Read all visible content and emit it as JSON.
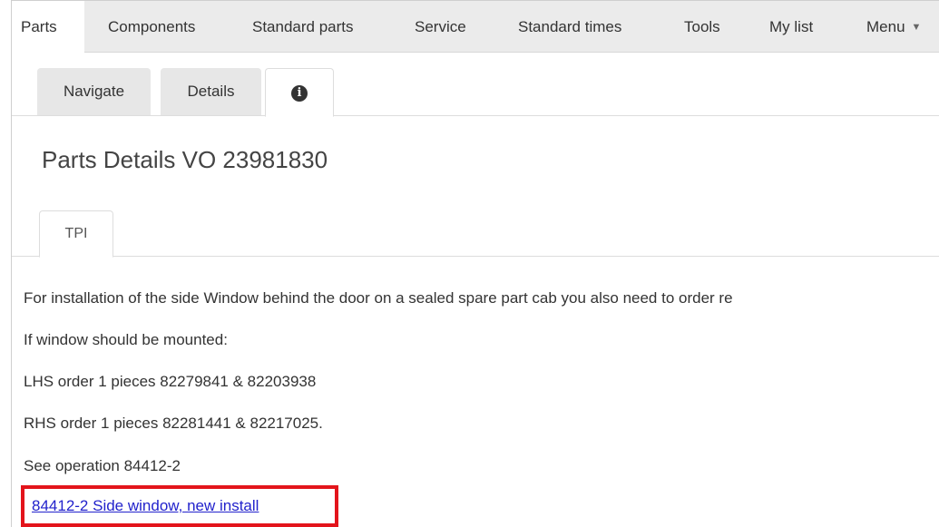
{
  "topnav": {
    "items": [
      {
        "label": "Parts",
        "active": true
      },
      {
        "label": "Components"
      },
      {
        "label": "Standard parts"
      },
      {
        "label": "Service"
      },
      {
        "label": "Standard times"
      },
      {
        "label": "Tools"
      },
      {
        "label": "My list"
      },
      {
        "label": "Menu",
        "icon": "caret-down-icon"
      }
    ]
  },
  "subtabs": {
    "items": [
      {
        "label": "Navigate"
      },
      {
        "label": "Details"
      },
      {
        "label": "",
        "icon": "info-icon",
        "active": true
      }
    ],
    "info_glyph": "i"
  },
  "page": {
    "title": "Parts Details VO 23981830"
  },
  "tpi": {
    "tab_label": "TPI"
  },
  "content": {
    "lines": [
      "For installation of the side Window behind the door on a sealed spare part cab you also need to order re",
      "If window should be mounted:",
      "LHS order 1 pieces 82279841 & 82203938",
      "RHS order 1 pieces 82281441 & 82217025.",
      "See operation 84412-2"
    ],
    "link_text": "84412-2 Side window, new install",
    "highlight_color": "#e3141b",
    "link_color": "#2222cc"
  }
}
